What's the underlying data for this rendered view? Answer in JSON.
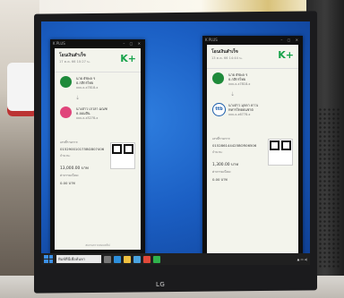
{
  "monitor": {
    "brand": "LG"
  },
  "taskbar": {
    "search_placeholder": "พิมพ์ที่นี่เพื่อค้นหา"
  },
  "slips": [
    {
      "app_title": "K PLUS",
      "title": "โอนเงินสำเร็จ",
      "date": "17 ต.ค. 66  10:27 น.",
      "brand": "K+",
      "sender": {
        "name": "นาย ธัชพล ร",
        "bank": "ธ.กสิกรไทย",
        "account": "xxx-x-x7818-x",
        "logo_color": "#1e8a3a"
      },
      "receiver": {
        "name": "นางสาว เกวลา มณฑ",
        "bank": "ธ.ออมสิน",
        "account": "xxx-x-x5278-x",
        "logo_color": "#e0457b"
      },
      "ref_label": "เลขที่รายการ:",
      "ref": "015290010175BGB07406",
      "amount_label": "จำนวน:",
      "amount": "13,000.00 บาท",
      "fee_label": "ค่าธรรมเนียม:",
      "fee": "0.00 บาท",
      "note": "สแกนตรวจสอบสลิป"
    },
    {
      "app_title": "K PLUS",
      "title": "โอนเงินสำเร็จ",
      "date": "13 ต.ค. 66  14:44 น.",
      "brand": "K+",
      "sender": {
        "name": "นาย ธัชพล ร",
        "bank": "ธ.กสิกรไทย",
        "account": "xxx-x-x7818-x",
        "logo_color": "#1e8a3a"
      },
      "receiver": {
        "name": "นางสาว มุกดา ดาวเ",
        "bank": "ทหารไทยธนชาต",
        "account": "xxx-x-x6778-x",
        "logo_color": "#1a5dab"
      },
      "ref_label": "เลขที่รายการ:",
      "ref": "015286144425BOR06506",
      "amount_label": "จำนวน:",
      "amount": "1,300.00 บาท",
      "fee_label": "ค่าธรรมเนียม:",
      "fee": "0.00 บาท",
      "note": ""
    }
  ]
}
